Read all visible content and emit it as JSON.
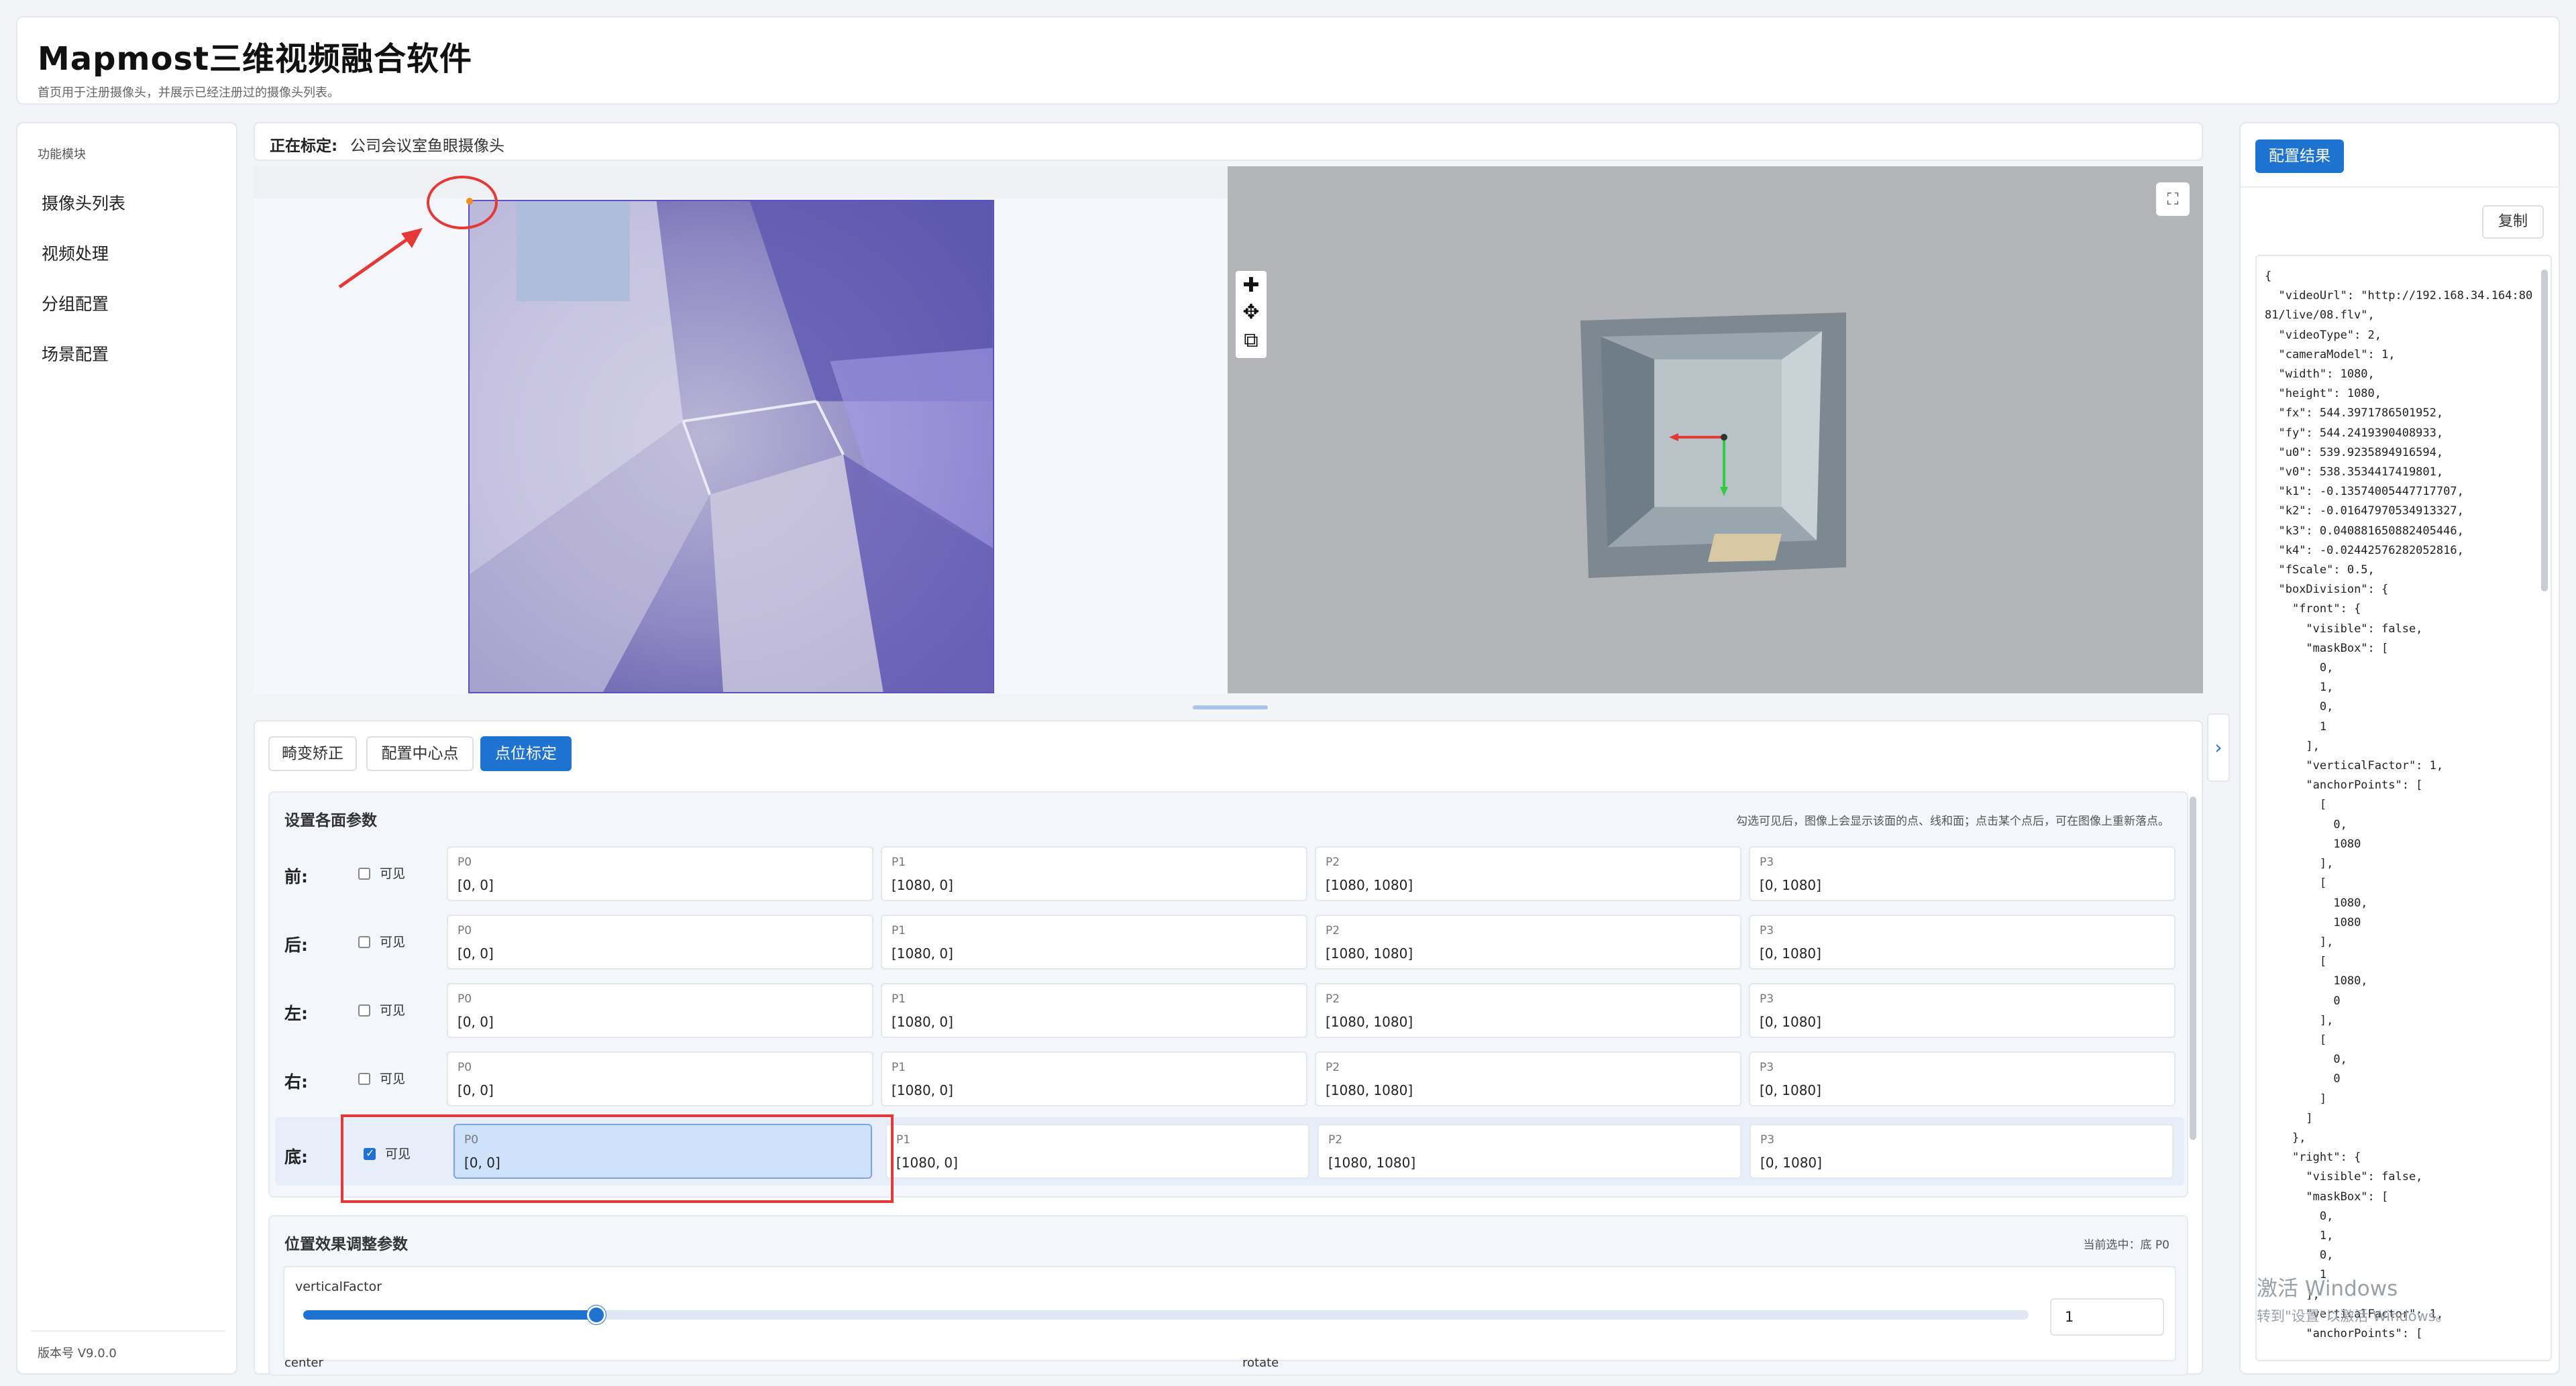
{
  "header": {
    "title": "Mapmost三维视频融合软件",
    "subtitle": "首页用于注册摄像头，并展示已经注册过的摄像头列表。"
  },
  "sidebar": {
    "section_title": "功能模块",
    "items": [
      {
        "label": "摄像头列表"
      },
      {
        "label": "视频处理"
      },
      {
        "label": "分组配置"
      },
      {
        "label": "场景配置"
      }
    ],
    "version": "版本号 V9.0.0"
  },
  "calibration": {
    "label": "正在标定:",
    "camera_name": "公司会议室鱼眼摄像头"
  },
  "tabs": [
    {
      "label": "畸变矫正",
      "active": false
    },
    {
      "label": "配置中心点",
      "active": false
    },
    {
      "label": "点位标定",
      "active": true
    }
  ],
  "faces_card": {
    "title": "设置各面参数",
    "hint": "勾选可见后，图像上会显示该面的点、线和面；点击某个点后，可在图像上重新落点。",
    "visible_label": "可见",
    "rows": [
      {
        "label": "前:",
        "visible": false,
        "points": [
          {
            "name": "P0",
            "value": "[0, 0]"
          },
          {
            "name": "P1",
            "value": "[1080, 0]"
          },
          {
            "name": "P2",
            "value": "[1080, 1080]"
          },
          {
            "name": "P3",
            "value": "[0, 1080]"
          }
        ]
      },
      {
        "label": "后:",
        "visible": false,
        "points": [
          {
            "name": "P0",
            "value": "[0, 0]"
          },
          {
            "name": "P1",
            "value": "[1080, 0]"
          },
          {
            "name": "P2",
            "value": "[1080, 1080]"
          },
          {
            "name": "P3",
            "value": "[0, 1080]"
          }
        ]
      },
      {
        "label": "左:",
        "visible": false,
        "points": [
          {
            "name": "P0",
            "value": "[0, 0]"
          },
          {
            "name": "P1",
            "value": "[1080, 0]"
          },
          {
            "name": "P2",
            "value": "[1080, 1080]"
          },
          {
            "name": "P3",
            "value": "[0, 1080]"
          }
        ]
      },
      {
        "label": "右:",
        "visible": false,
        "points": [
          {
            "name": "P0",
            "value": "[0, 0]"
          },
          {
            "name": "P1",
            "value": "[1080, 0]"
          },
          {
            "name": "P2",
            "value": "[1080, 1080]"
          },
          {
            "name": "P3",
            "value": "[0, 1080]"
          }
        ]
      },
      {
        "label": "底:",
        "visible": true,
        "points": [
          {
            "name": "P0",
            "value": "[0, 0]"
          },
          {
            "name": "P1",
            "value": "[1080, 0]"
          },
          {
            "name": "P2",
            "value": "[1080, 1080]"
          },
          {
            "name": "P3",
            "value": "[0, 1080]"
          }
        ]
      }
    ]
  },
  "position_card": {
    "title": "位置效果调整参数",
    "selected_info": "当前选中：底 P0",
    "vertical_factor_label": "verticalFactor",
    "vertical_factor_value": "1",
    "slider_fraction": 0.17,
    "center_label": "center",
    "rotate_label": "rotate"
  },
  "result_panel": {
    "button": "配置结果",
    "copy": "复制",
    "json": "{\n  \"videoUrl\": \"http://192.168.34.164:8081/live/08.flv\",\n  \"videoType\": 2,\n  \"cameraModel\": 1,\n  \"width\": 1080,\n  \"height\": 1080,\n  \"fx\": 544.3971786501952,\n  \"fy\": 544.2419390408933,\n  \"u0\": 539.9235894916594,\n  \"v0\": 538.3534417419801,\n  \"k1\": -0.13574005447717707,\n  \"k2\": -0.01647970534913327,\n  \"k3\": 0.040881650882405446,\n  \"k4\": -0.02442576282052816,\n  \"fScale\": 0.5,\n  \"boxDivision\": {\n    \"front\": {\n      \"visible\": false,\n      \"maskBox\": [\n        0,\n        1,\n        0,\n        1\n      ],\n      \"verticalFactor\": 1,\n      \"anchorPoints\": [\n        [\n          0,\n          1080\n        ],\n        [\n          1080,\n          1080\n        ],\n        [\n          1080,\n          0\n        ],\n        [\n          0,\n          0\n        ]\n      ]\n    },\n    \"right\": {\n      \"visible\": false,\n      \"maskBox\": [\n        0,\n        1,\n        0,\n        1\n      ],\n      \"verticalFactor\": 1,\n      \"anchorPoints\": ["
  },
  "watermark": {
    "line1": "激活 Windows",
    "line2": "转到\"设置\"以激活 Windows。"
  },
  "colors": {
    "primary": "#1f73d0",
    "highlight_red": "#e53935",
    "selected_point_bg": "#cfe2fb"
  }
}
